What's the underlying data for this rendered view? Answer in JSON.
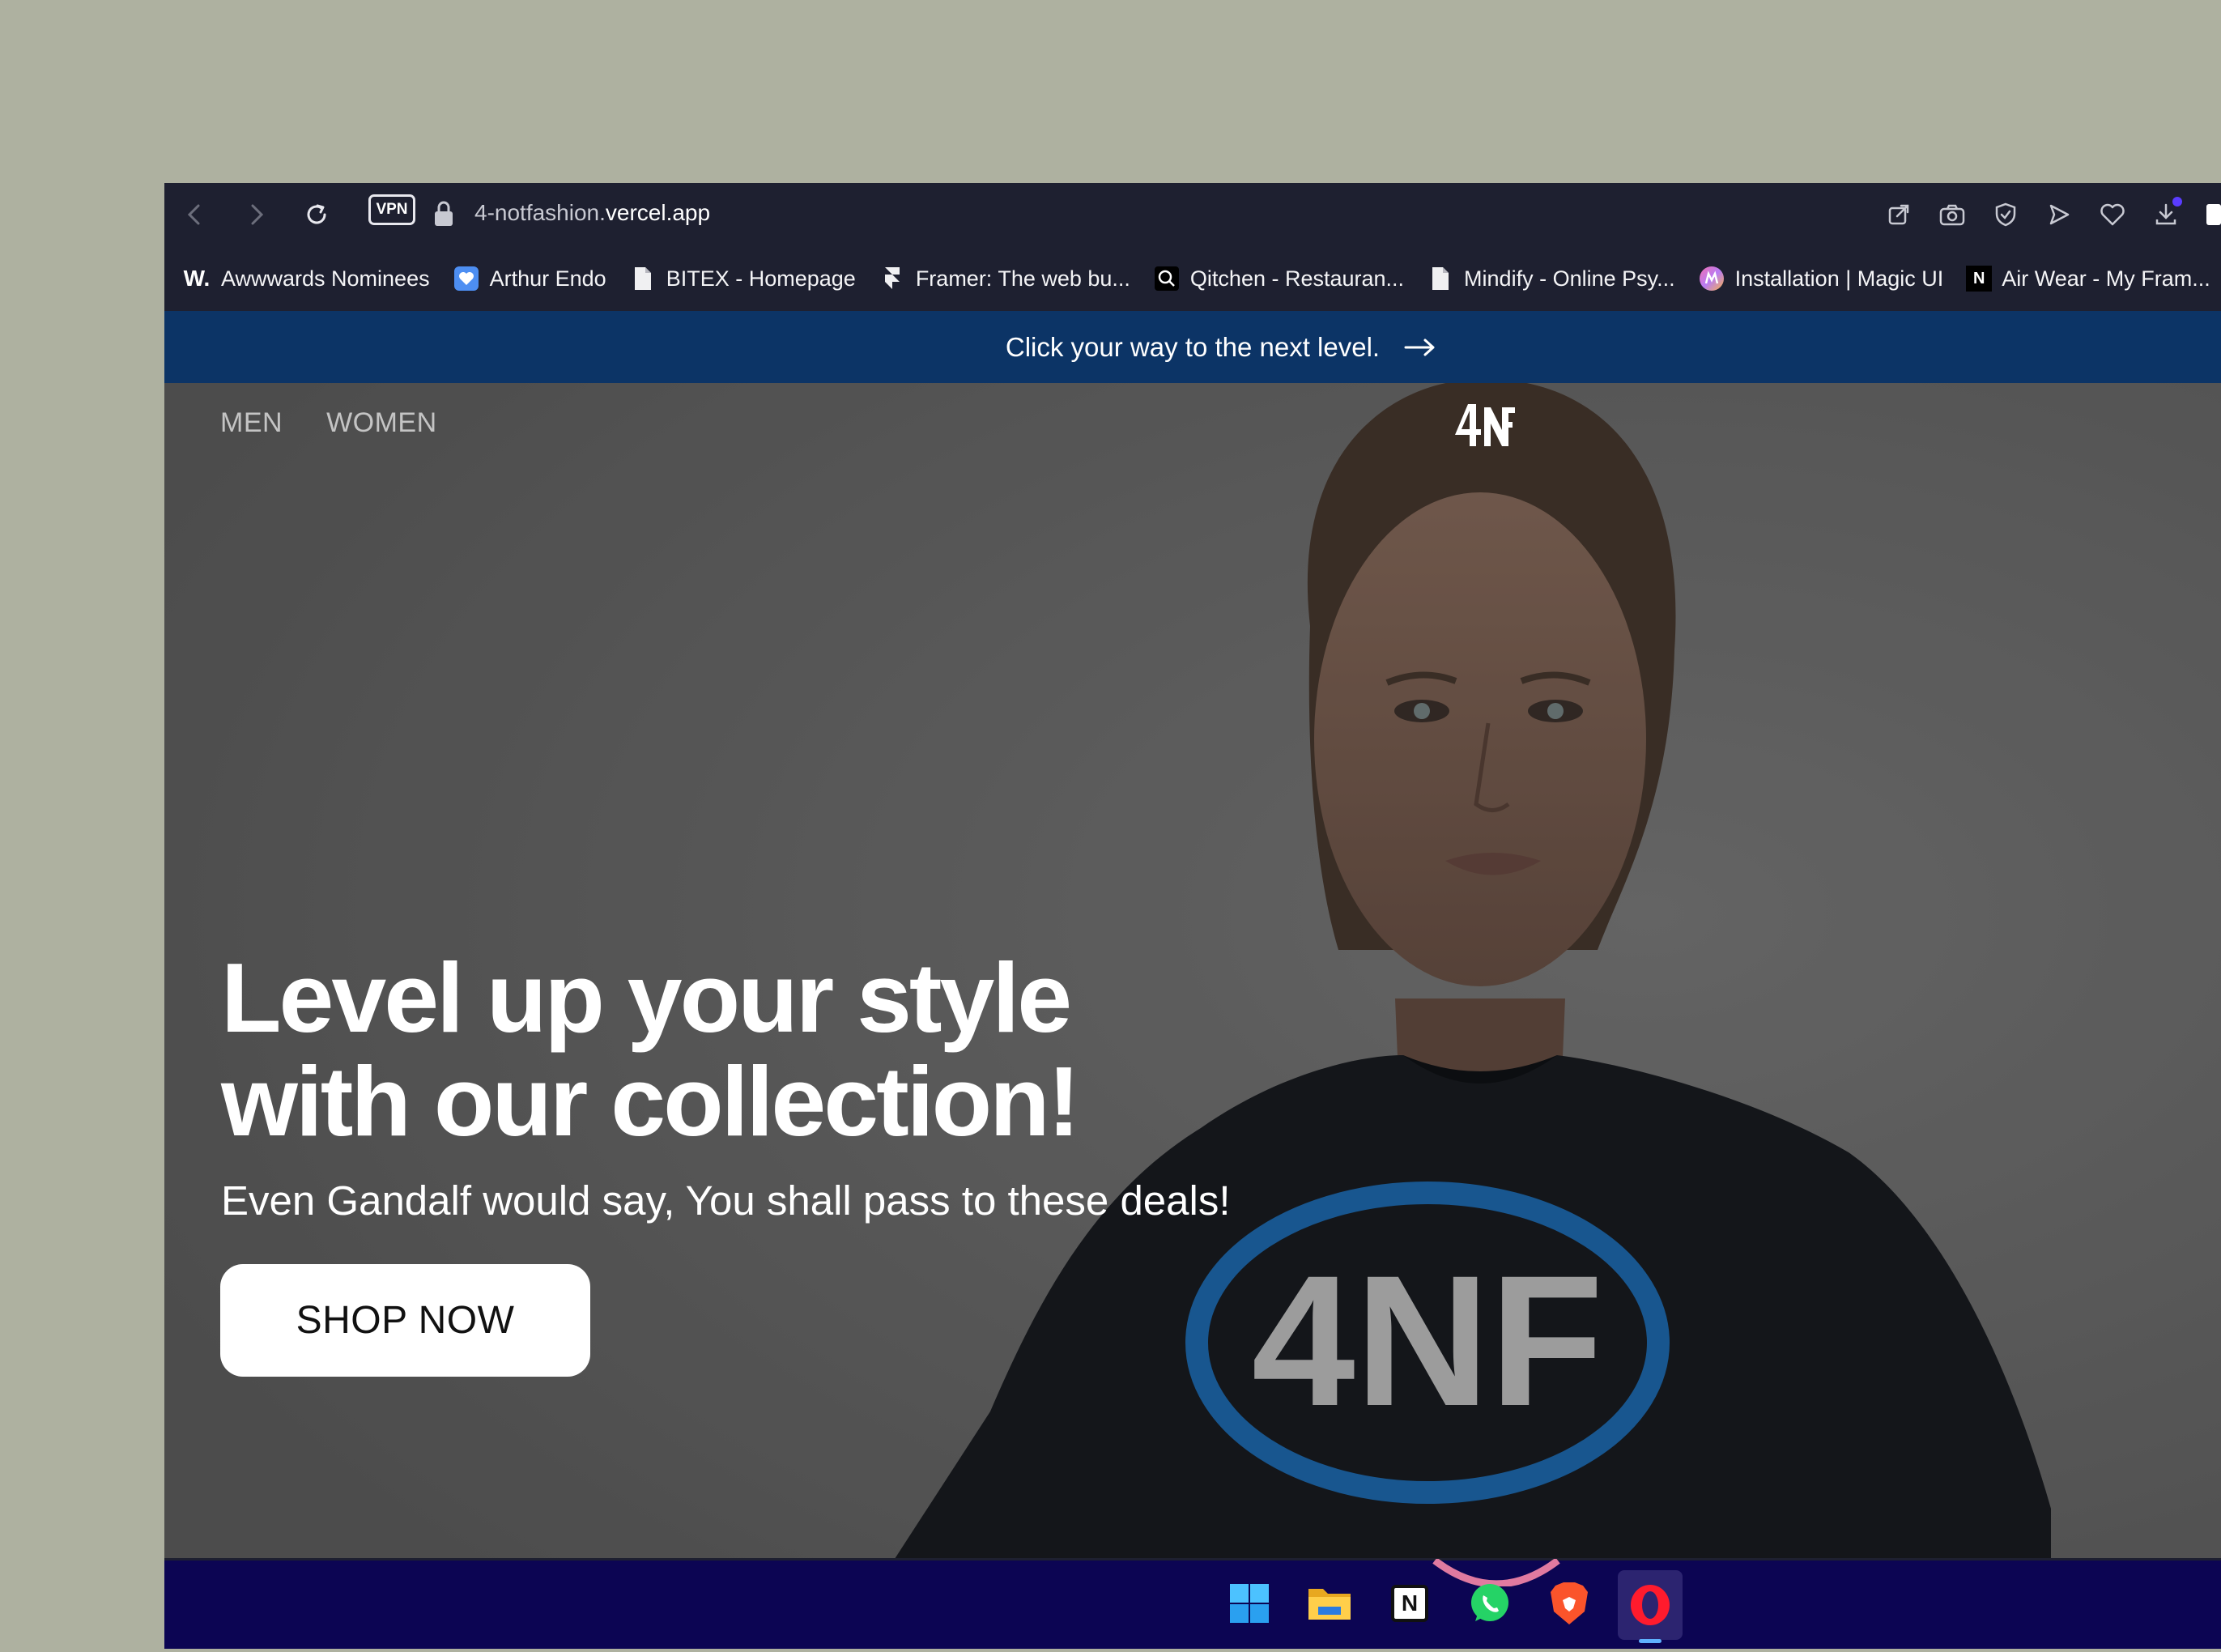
{
  "browser": {
    "vpn_label": "VPN",
    "url_prefix": "4-notfashion.",
    "url_host": "vercel.app",
    "bookmarks": [
      {
        "icon": "awwwards-icon",
        "label": "Awwwards Nominees"
      },
      {
        "icon": "heart-shield-icon",
        "label": "Arthur Endo"
      },
      {
        "icon": "page-icon",
        "label": "BITEX - Homepage"
      },
      {
        "icon": "framer-icon",
        "label": "Framer: The web bu..."
      },
      {
        "icon": "search-magnifier-icon",
        "label": "Qitchen - Restauran..."
      },
      {
        "icon": "page-icon",
        "label": "Mindify - Online Psy..."
      },
      {
        "icon": "magic-ui-icon",
        "label": "Installation | Magic UI"
      },
      {
        "icon": "notion-icon",
        "label": "Air Wear - My Fram..."
      }
    ],
    "awwwards_glyph": "W.",
    "notion_glyph": "N"
  },
  "page": {
    "promo_text": "Click your way to the next level.",
    "nav": {
      "men": "MEN",
      "women": "WOMEN"
    },
    "headline_line1": "Level up your style",
    "headline_line2": "with our collection!",
    "subheadline": "Even Gandalf would say, You shall pass to these deals!",
    "cta_label": "SHOP NOW",
    "shirt_logo_text": "4NF"
  },
  "taskbar": {
    "apps": [
      "windows-start-icon",
      "file-explorer-icon",
      "notion-icon",
      "whatsapp-icon",
      "brave-icon",
      "opera-icon"
    ],
    "notion_glyph": "N"
  },
  "colors": {
    "desktop": "#aeb1a0",
    "browser_chrome": "#1e2030",
    "promo_bar": "#0c3466",
    "taskbar": "#0c0553",
    "shirt_ring": "#1f6fb8"
  }
}
